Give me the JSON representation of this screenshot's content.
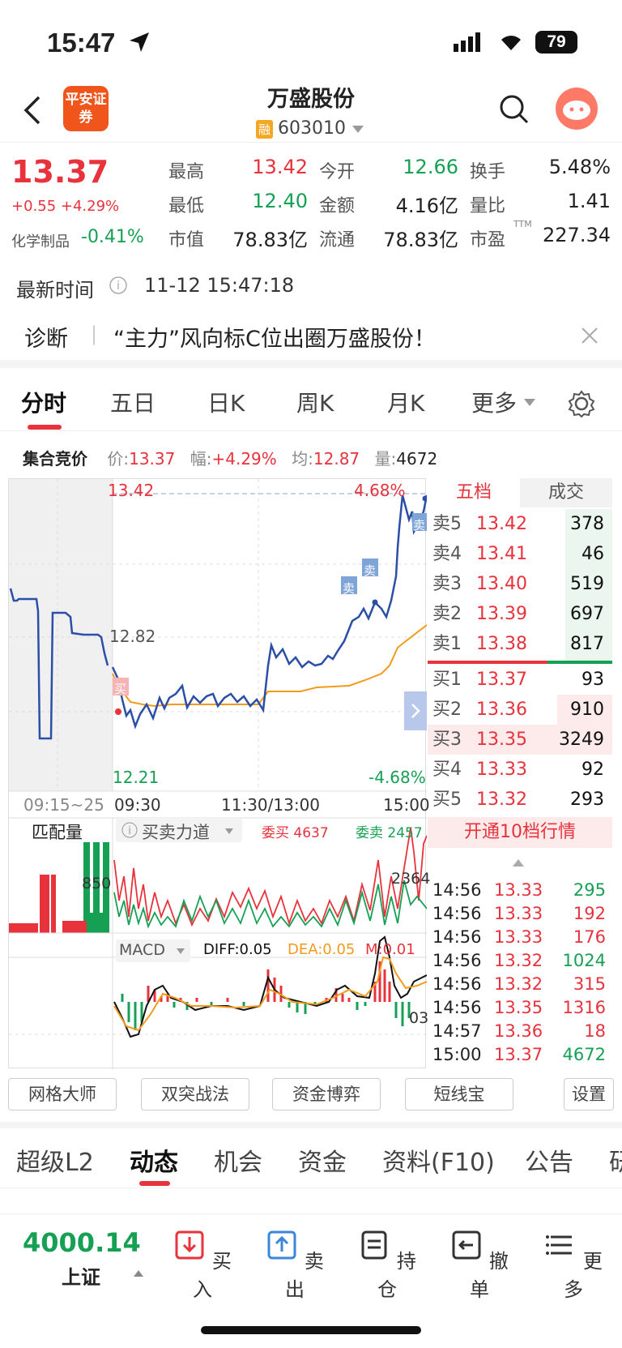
{
  "status": {
    "time": "15:47",
    "battery": "79"
  },
  "header": {
    "logo": "平安证券",
    "title": "万盛股份",
    "rong": "融",
    "code": "603010"
  },
  "quote": {
    "price": "13.37",
    "change": "+0.55 +4.29%",
    "sector": "化学制品",
    "sector_chg": "-0.41%",
    "items": [
      {
        "label": "最高",
        "value": "13.42"
      },
      {
        "label": "今开",
        "value": "12.66"
      },
      {
        "label": "换手",
        "value": "5.48%"
      },
      {
        "label": "最低",
        "value": "12.40"
      },
      {
        "label": "金额",
        "value": "4.16亿"
      },
      {
        "label": "量比",
        "value": "1.41"
      },
      {
        "label": "市值",
        "value": "78.83亿"
      },
      {
        "label": "流通",
        "value": "78.83亿"
      },
      {
        "label": "市盈",
        "value": "227.34"
      }
    ],
    "ttm": "TTM"
  },
  "latest": {
    "label": "最新时间",
    "value": "11-12 15:47:18"
  },
  "diag": {
    "label": "诊断",
    "text": "“主力”风向标C位出圈万盛股份！"
  },
  "chart_tabs": [
    "分时",
    "五日",
    "日K",
    "周K",
    "月K",
    "更多"
  ],
  "auction": {
    "label": "集合竞价",
    "price_lbl": "价:",
    "price": "13.37",
    "amp_lbl": "幅:",
    "amp": "+4.29%",
    "avg_lbl": "均:",
    "avg": "12.87",
    "vol_lbl": "量:",
    "vol": "4672"
  },
  "chart_labels": {
    "high": "13.42",
    "high_pct": "4.68%",
    "mid": "12.82",
    "low": "12.21",
    "low_pct": "-4.68%",
    "t0": "09:15~25",
    "t1": "09:30",
    "t2": "11:30/13:00",
    "t3": "15:00",
    "buy_mark": "买",
    "sell_mark": "卖"
  },
  "sub": {
    "match_label": "匹配量",
    "match_value": "850",
    "force_label": "买卖力道",
    "wb_label": "委买 4637",
    "ws_label": "委卖 2457",
    "force_value": "2364",
    "macd_label": "MACD",
    "diff": "DIFF:0.05",
    "dea": "DEA:0.05",
    "m": "M:0.01",
    "macd_value": "03"
  },
  "orderbook": {
    "tab_five": "五档",
    "tab_trade": "成交",
    "asks": [
      {
        "lbl": "卖5",
        "px": "13.42",
        "vol": "378"
      },
      {
        "lbl": "卖4",
        "px": "13.41",
        "vol": "46"
      },
      {
        "lbl": "卖3",
        "px": "13.40",
        "vol": "519"
      },
      {
        "lbl": "卖2",
        "px": "13.39",
        "vol": "697"
      },
      {
        "lbl": "卖1",
        "px": "13.38",
        "vol": "817"
      }
    ],
    "bids": [
      {
        "lbl": "买1",
        "px": "13.37",
        "vol": "93"
      },
      {
        "lbl": "买2",
        "px": "13.36",
        "vol": "910"
      },
      {
        "lbl": "买3",
        "px": "13.35",
        "vol": "3249"
      },
      {
        "lbl": "买4",
        "px": "13.33",
        "vol": "92"
      },
      {
        "lbl": "买5",
        "px": "13.32",
        "vol": "293"
      }
    ],
    "open10": "开通10档行情",
    "trades": [
      {
        "t": "14:56",
        "px": "13.33",
        "v": "295",
        "c": "#16a054"
      },
      {
        "t": "14:56",
        "px": "13.33",
        "v": "192",
        "c": "#e8323c"
      },
      {
        "t": "14:56",
        "px": "13.33",
        "v": "176",
        "c": "#e8323c"
      },
      {
        "t": "14:56",
        "px": "13.32",
        "v": "1024",
        "c": "#16a054"
      },
      {
        "t": "14:56",
        "px": "13.32",
        "v": "315",
        "c": "#e8323c"
      },
      {
        "t": "14:56",
        "px": "13.35",
        "v": "1316",
        "c": "#e8323c"
      },
      {
        "t": "14:57",
        "px": "13.36",
        "v": "18",
        "c": "#e8323c"
      },
      {
        "t": "15:00",
        "px": "13.37",
        "v": "4672",
        "c": "#16a054"
      }
    ]
  },
  "tools": [
    "网格大师",
    "双突战法",
    "资金博弈",
    "短线宝",
    "设置"
  ],
  "info_tabs": [
    "超级L2",
    "动态",
    "机会",
    "资金",
    "资料(F10)",
    "公告",
    "研"
  ],
  "bottom": {
    "index_value": "4000.14",
    "index_name": "上证",
    "items": [
      "买入",
      "卖出",
      "持仓",
      "撤单",
      "更多"
    ]
  }
}
